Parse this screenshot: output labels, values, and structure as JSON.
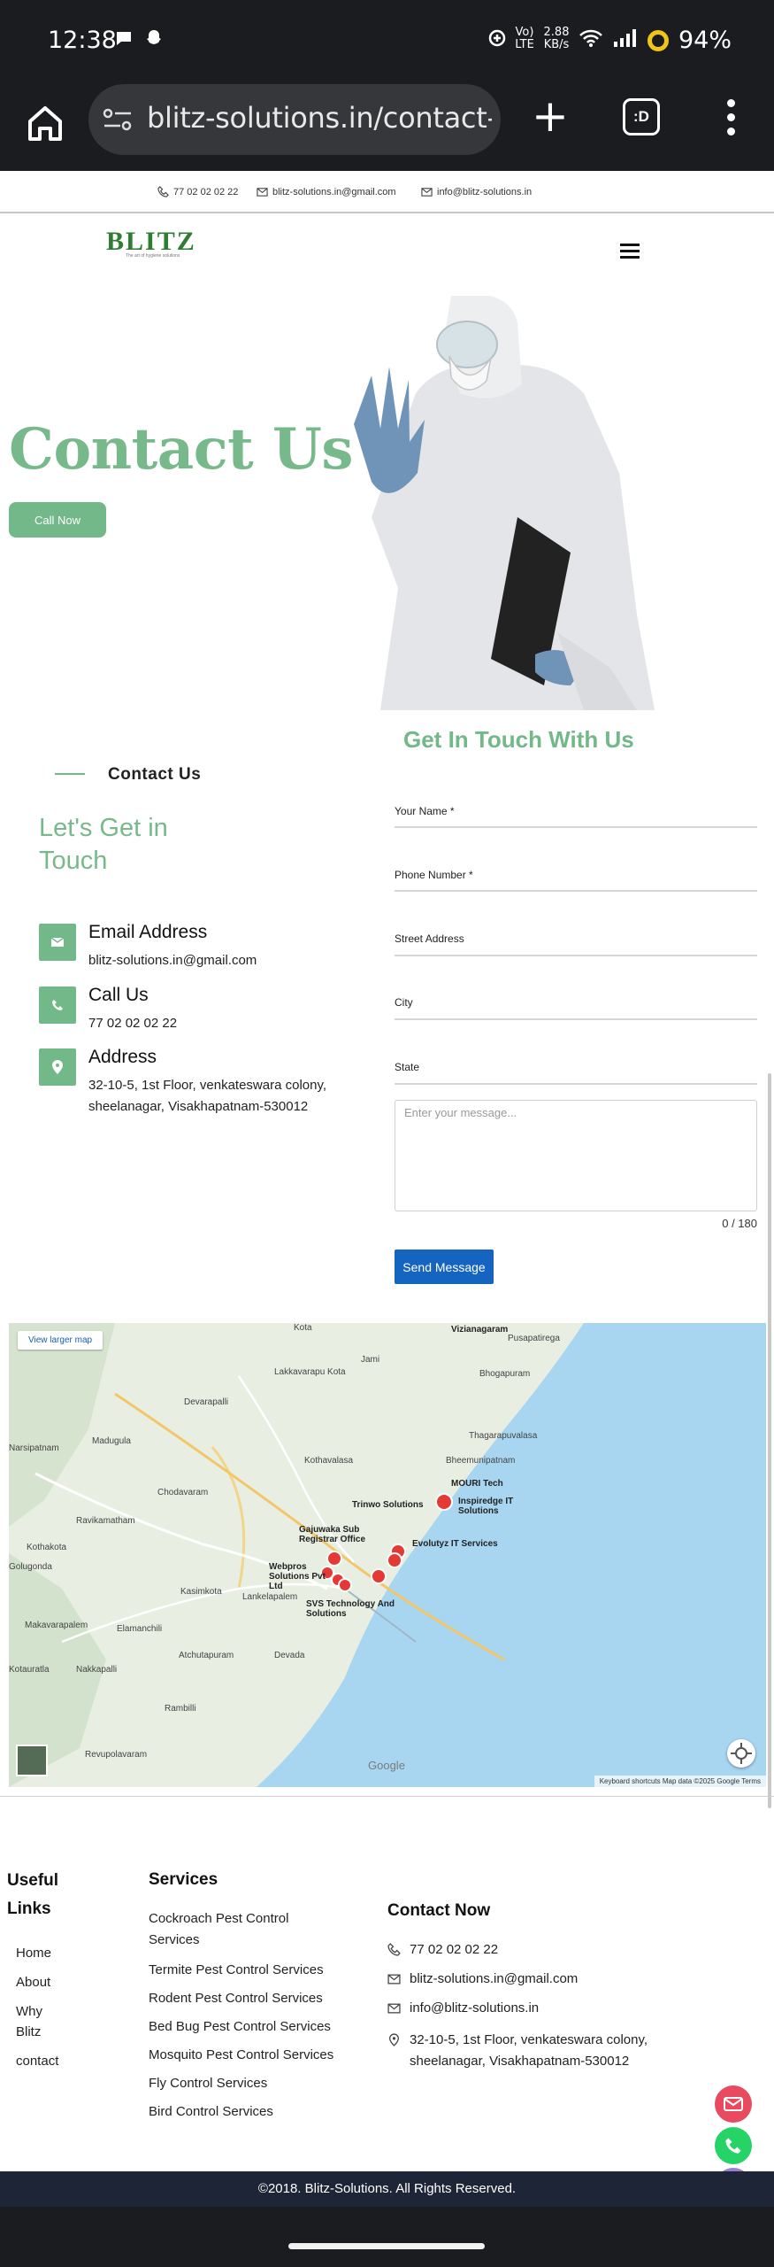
{
  "status_bar": {
    "time": "12:38",
    "network_type": "Vo) LTE",
    "net_speed": "2.88 KB/s",
    "battery": "94%"
  },
  "browser": {
    "url": "blitz-solutions.in/contact-u",
    "tabs_label": ":D"
  },
  "top_strip": {
    "phone": "77 02 02 02 22",
    "email1": "blitz-solutions.in@gmail.com",
    "email2": "info@blitz-solutions.in"
  },
  "logo": {
    "text": "BLITZ",
    "tagline": "The art of hygiene solutions"
  },
  "hero": {
    "title": "Contact Us",
    "cta": "Call Now"
  },
  "contact": {
    "section_label": "Contact Us",
    "heading": "Let's Get in Touch",
    "form_heading": "Get In Touch With Us",
    "items": [
      {
        "title": "Email Address",
        "value": "blitz-solutions.in@gmail.com",
        "icon": "mail-icon"
      },
      {
        "title": "Call Us",
        "value": "77 02 02 02 22",
        "icon": "phone-icon"
      },
      {
        "title": "Address",
        "value": "32-10-5, 1st Floor, venkateswara colony, sheelanagar, Visakhapatnam-530012",
        "icon": "location-pin-icon"
      }
    ]
  },
  "form": {
    "fields": [
      {
        "label": "Your Name *"
      },
      {
        "label": "Phone Number *"
      },
      {
        "label": "Street Address"
      },
      {
        "label": "City"
      },
      {
        "label": "State"
      }
    ],
    "message_placeholder": "Enter your message...",
    "counter": "0 / 180",
    "submit": "Send Message"
  },
  "map": {
    "view_larger": "View larger map",
    "attribution": "Keyboard shortcuts    Map data ©2025 Google    Terms",
    "google": "Google",
    "labels": [
      "Kota",
      "Vizianagaram",
      "Pusapatirega",
      "Lakkavarapu Kota",
      "Jami",
      "Bhogapuram",
      "Devarapalli",
      "Madugula",
      "Thagarapuvalasa",
      "Kothavalasa",
      "Bheemunipatnam",
      "Chodavaram",
      "MOURI Tech",
      "Trinwo Solutions",
      "Inspiredge IT Solutions",
      "Ravikamatham",
      "Kothakota",
      "Gajuwaka Sub Registrar Office",
      "Evolutyz IT Services",
      "Webpros Solutions Pvt Ltd",
      "Kasimkota",
      "Lankelapalem",
      "SVS Technology And Solutions",
      "Makavarapalem",
      "Elamanchili",
      "Atchutapuram",
      "Devada",
      "Rambilli",
      "Revupolavaram",
      "Narsipatnam",
      "Golugonda",
      "Kotauratla",
      "Nakkapalli"
    ]
  },
  "footer": {
    "useful_links_title": "Useful Links",
    "links": [
      "Home",
      "About",
      "Why Blitz",
      "contact"
    ],
    "services_title": "Services",
    "services": [
      "Cockroach Pest Control Services",
      "Termite Pest Control Services",
      "Rodent Pest Control Services",
      "Bed Bug Pest Control Services",
      "Mosquito Pest Control Services",
      "Fly Control Services",
      "Bird Control Services"
    ],
    "contact_title": "Contact Now",
    "contact_phone": "77 02 02 02 22",
    "contact_email1": "blitz-solutions.in@gmail.com",
    "contact_email2": "info@blitz-solutions.in",
    "contact_address": "32-10-5, 1st Floor, venkateswara colony, sheelanagar, Visakhapatnam-530012",
    "copyright": "©2018. Blitz-Solutions. All Rights Reserved."
  },
  "colors": {
    "accent_green": "#73b889",
    "send_blue": "#1565c0",
    "footer_bar": "#1d2537"
  }
}
